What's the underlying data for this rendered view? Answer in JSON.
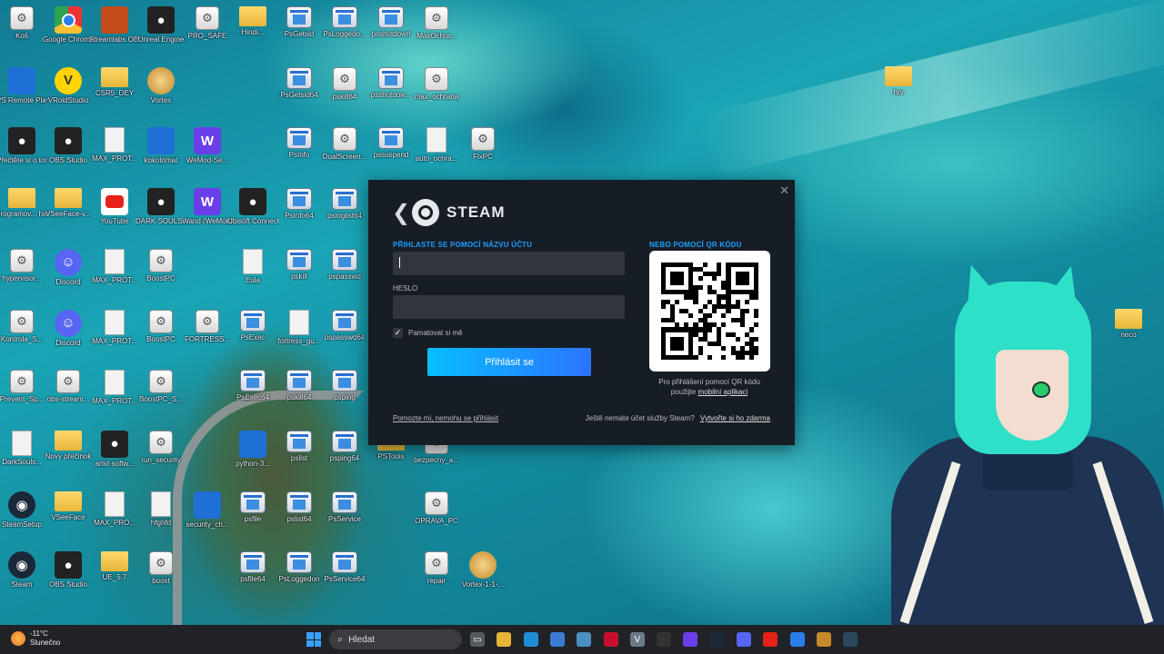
{
  "desktop": {
    "icons": [
      {
        "label": "Koš",
        "type": "cfg",
        "col": 0,
        "row": 0
      },
      {
        "label": "Google Chrome",
        "type": "chrome",
        "col": 1,
        "row": 0
      },
      {
        "label": "Streamlabs OBS",
        "type": "orange",
        "col": 2,
        "row": 0
      },
      {
        "label": "Unreal Engine",
        "type": "dark",
        "col": 3,
        "row": 0
      },
      {
        "label": "PRO_SAFE",
        "type": "cfg",
        "col": 4,
        "row": 0
      },
      {
        "label": "Hindi...",
        "type": "folder",
        "col": 5,
        "row": 0
      },
      {
        "label": "PsGetsid",
        "type": "app",
        "col": 6,
        "row": 0
      },
      {
        "label": "PsLoggedo...",
        "type": "app",
        "col": 7,
        "row": 0
      },
      {
        "label": "psshutdown",
        "type": "app",
        "col": 8,
        "row": 0
      },
      {
        "label": "MaxOchra...",
        "type": "cfg",
        "col": 9,
        "row": 0
      },
      {
        "label": "PS Remote Play",
        "type": "blue",
        "col": 0,
        "row": 1
      },
      {
        "label": "VRoidStudio",
        "type": "green",
        "col": 1,
        "row": 1
      },
      {
        "label": "CSR5_DEY",
        "type": "folder",
        "col": 2,
        "row": 1
      },
      {
        "label": "Vortex",
        "type": "vortex",
        "col": 3,
        "row": 1
      },
      {
        "label": "PsGetsid64",
        "type": "app",
        "col": 6,
        "row": 1
      },
      {
        "label": "pskill64",
        "type": "cfg",
        "col": 7,
        "row": 1
      },
      {
        "label": "psshutdow...",
        "type": "app",
        "col": 8,
        "row": 1
      },
      {
        "label": "max_ochrana",
        "type": "cfg",
        "col": 9,
        "row": 1
      },
      {
        "label": "Přečtěte si o tomto",
        "type": "dark",
        "col": 0,
        "row": 2
      },
      {
        "label": "OBS Studio",
        "type": "dark",
        "col": 1,
        "row": 2
      },
      {
        "label": "MAX_PROT...",
        "type": "doc",
        "col": 2,
        "row": 2
      },
      {
        "label": "kokotomat",
        "type": "blue",
        "col": 3,
        "row": 2
      },
      {
        "label": "WeMod-Se...",
        "type": "purple",
        "col": 4,
        "row": 2
      },
      {
        "label": "PsInfo",
        "type": "app",
        "col": 6,
        "row": 2
      },
      {
        "label": "DualScreen...",
        "type": "cfg",
        "col": 7,
        "row": 2
      },
      {
        "label": "pssuspend",
        "type": "app",
        "col": 8,
        "row": 2
      },
      {
        "label": "auto_ochra...",
        "type": "doc",
        "col": 9,
        "row": 2
      },
      {
        "label": "FixPC",
        "type": "cfg",
        "col": 10,
        "row": 2
      },
      {
        "label": "programov... hier",
        "type": "folder",
        "col": 0,
        "row": 3
      },
      {
        "label": "VSeeFace-v...",
        "type": "folder",
        "col": 1,
        "row": 3
      },
      {
        "label": "YouTube",
        "type": "yt",
        "col": 2,
        "row": 3
      },
      {
        "label": "DARK SOULS...",
        "type": "dark",
        "col": 3,
        "row": 3
      },
      {
        "label": "Wand (WeMod)",
        "type": "purple",
        "col": 4,
        "row": 3
      },
      {
        "label": "Ubisoft Connect",
        "type": "dark",
        "col": 5,
        "row": 3
      },
      {
        "label": "PsInfo64",
        "type": "app",
        "col": 6,
        "row": 3
      },
      {
        "label": "psloglist64",
        "type": "app",
        "col": 7,
        "row": 3
      },
      {
        "label": "hypervisor...",
        "type": "cfg",
        "col": 0,
        "row": 4
      },
      {
        "label": "Discord",
        "type": "discord",
        "col": 1,
        "row": 4
      },
      {
        "label": "MAX_PROT...",
        "type": "doc",
        "col": 2,
        "row": 4
      },
      {
        "label": "BoostPC",
        "type": "cfg",
        "col": 3,
        "row": 4
      },
      {
        "label": "Eula",
        "type": "doc",
        "col": 5,
        "row": 4
      },
      {
        "label": "pskill",
        "type": "app",
        "col": 6,
        "row": 4
      },
      {
        "label": "pspasswd",
        "type": "app",
        "col": 7,
        "row": 4
      },
      {
        "label": "Kontrola_S...",
        "type": "cfg",
        "col": 0,
        "row": 5
      },
      {
        "label": "Discord",
        "type": "discord",
        "col": 1,
        "row": 5
      },
      {
        "label": "MAX_PROT...",
        "type": "doc",
        "col": 2,
        "row": 5
      },
      {
        "label": "BoostPC",
        "type": "cfg",
        "col": 3,
        "row": 5
      },
      {
        "label": "FORTRESS...",
        "type": "cfg",
        "col": 4,
        "row": 5
      },
      {
        "label": "PsExec",
        "type": "app",
        "col": 5,
        "row": 5
      },
      {
        "label": "fortress_gu...",
        "type": "doc",
        "col": 6,
        "row": 5
      },
      {
        "label": "pspasswd64",
        "type": "app",
        "col": 7,
        "row": 5
      },
      {
        "label": "Prevent_Sp...",
        "type": "cfg",
        "col": 0,
        "row": 6
      },
      {
        "label": "obs-stream...",
        "type": "cfg",
        "col": 1,
        "row": 6
      },
      {
        "label": "MAX_PROT...",
        "type": "doc",
        "col": 2,
        "row": 6
      },
      {
        "label": "BoostPC_S...",
        "type": "cfg",
        "col": 3,
        "row": 6
      },
      {
        "label": "PsExec64",
        "type": "app",
        "col": 5,
        "row": 6
      },
      {
        "label": "pskill64",
        "type": "app",
        "col": 6,
        "row": 6
      },
      {
        "label": "psping",
        "type": "app",
        "col": 7,
        "row": 6
      },
      {
        "label": "DarkSouls...",
        "type": "doc",
        "col": 0,
        "row": 7
      },
      {
        "label": "Nový přečinok",
        "type": "folder",
        "col": 1,
        "row": 7
      },
      {
        "label": "amd-softw...",
        "type": "dark",
        "col": 2,
        "row": 7
      },
      {
        "label": "run_security",
        "type": "cfg",
        "col": 3,
        "row": 7
      },
      {
        "label": "python-3...",
        "type": "blue",
        "col": 5,
        "row": 7
      },
      {
        "label": "pslist",
        "type": "app",
        "col": 6,
        "row": 7
      },
      {
        "label": "psping64",
        "type": "app",
        "col": 7,
        "row": 7
      },
      {
        "label": "PSTools",
        "type": "folder",
        "col": 8,
        "row": 7
      },
      {
        "label": "bezpecny_a...",
        "type": "cfg",
        "col": 9,
        "row": 7
      },
      {
        "label": "SteamSetup",
        "type": "steam",
        "col": 0,
        "row": 8
      },
      {
        "label": "VSeeFace",
        "type": "folder",
        "col": 1,
        "row": 8
      },
      {
        "label": "MAX_PRO...",
        "type": "doc",
        "col": 2,
        "row": 8
      },
      {
        "label": "hfghfd",
        "type": "doc",
        "col": 3,
        "row": 8
      },
      {
        "label": "security_ch...",
        "type": "blue",
        "col": 4,
        "row": 8
      },
      {
        "label": "psfile",
        "type": "app",
        "col": 5,
        "row": 8
      },
      {
        "label": "pslist64",
        "type": "app",
        "col": 6,
        "row": 8
      },
      {
        "label": "PsService",
        "type": "app",
        "col": 7,
        "row": 8
      },
      {
        "label": "OPRAVA_PC",
        "type": "cfg",
        "col": 9,
        "row": 8
      },
      {
        "label": "Steam",
        "type": "steam",
        "col": 0,
        "row": 9
      },
      {
        "label": "OBS Studio",
        "type": "dark",
        "col": 1,
        "row": 9
      },
      {
        "label": "UE_5.7",
        "type": "folder",
        "col": 2,
        "row": 9
      },
      {
        "label": "boost",
        "type": "cfg",
        "col": 3,
        "row": 9
      },
      {
        "label": "psfile64",
        "type": "app",
        "col": 5,
        "row": 9
      },
      {
        "label": "PsLoggedon",
        "type": "app",
        "col": 6,
        "row": 9
      },
      {
        "label": "PsService64",
        "type": "app",
        "col": 7,
        "row": 9
      },
      {
        "label": "repair",
        "type": "cfg",
        "col": 9,
        "row": 9
      },
      {
        "label": "Vortex-1-1-...",
        "type": "vortex",
        "col": 10,
        "row": 9
      }
    ],
    "right_icons": [
      {
        "label": "hry",
        "type": "folder",
        "pos": "top"
      },
      {
        "label": "neco",
        "type": "folder",
        "pos": "mid"
      }
    ]
  },
  "steam": {
    "logo_text": "STEAM",
    "account_label": "PŘIHLASTE SE POMOCÍ NÁZVU ÚČTU",
    "account_value": "",
    "password_label": "HESLO",
    "password_value": "",
    "remember_label": "Pamatovat si mě",
    "remember_checked": true,
    "login_button": "Přihlásit se",
    "qr_label": "NEBO POMOCÍ QR KÓDU",
    "qr_note_1": "Pro přihlášení pomocí QR kódu",
    "qr_note_2": "použijte",
    "qr_note_link": "mobilní aplikaci",
    "help_link": "Pomozte mi, nemohu se přihlásit",
    "no_account_text": "Ještě nemáte účet služby Steam?",
    "create_link": "Vytvořte si ho zdarma",
    "close_symbol": "✕",
    "back_symbol": "❮"
  },
  "taskbar": {
    "weather_temp": "-11°C",
    "weather_desc": "Slunečno",
    "search_placeholder": "Hledat",
    "pinned": [
      {
        "name": "task-view-icon",
        "glyph": "▭",
        "color": "#555a60"
      },
      {
        "name": "file-explorer-icon",
        "glyph": "",
        "color": "#e8b53a"
      },
      {
        "name": "edge-icon",
        "glyph": "",
        "color": "#1f8ed6"
      },
      {
        "name": "store-icon",
        "glyph": "",
        "color": "#3a7bd5"
      },
      {
        "name": "app-icon",
        "glyph": "",
        "color": "#4a90c0"
      },
      {
        "name": "amd-icon",
        "glyph": "",
        "color": "#c8102e"
      },
      {
        "name": "vroid-icon",
        "glyph": "V",
        "color": "#6a7a88"
      },
      {
        "name": "obs-icon",
        "glyph": "",
        "color": "#333"
      },
      {
        "name": "wand-icon",
        "glyph": "",
        "color": "#6a3ee8"
      },
      {
        "name": "steam-taskbar-icon",
        "glyph": "",
        "color": "#1b2838"
      },
      {
        "name": "discord-taskbar-icon",
        "glyph": "",
        "color": "#5865f2"
      },
      {
        "name": "youtube-taskbar-icon",
        "glyph": "",
        "color": "#e62117"
      },
      {
        "name": "chrome-taskbar-icon",
        "glyph": "",
        "color": "#2b7de9"
      },
      {
        "name": "vortex-taskbar-icon",
        "glyph": "",
        "color": "#c58a2a"
      },
      {
        "name": "steam-active-icon",
        "glyph": "",
        "color": "#2a475e"
      }
    ]
  }
}
